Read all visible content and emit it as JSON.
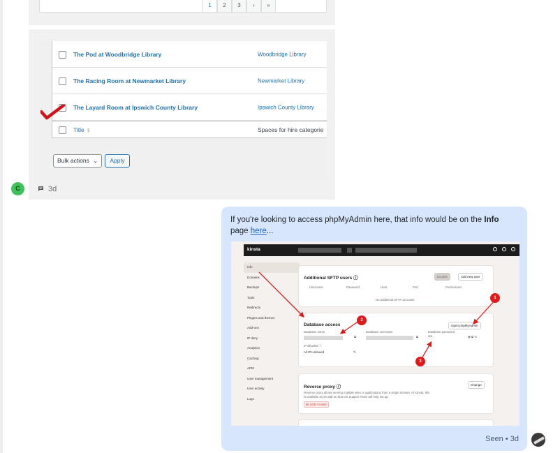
{
  "incoming": {
    "pagination": [
      "1",
      "2",
      "3",
      "›",
      "»"
    ],
    "rows": [
      {
        "title": "The Pod at Woodbridge Library",
        "library": "Woodbridge Library"
      },
      {
        "title": "The Racing Room at Newmarket Library",
        "library": "Newmarket Library"
      },
      {
        "title": "The Layard Room at Ipswich County Library",
        "library": "Ipswich County Library"
      }
    ],
    "footer": {
      "title": "Title",
      "sort_icon": "sort-arrows-icon",
      "column": "Spaces for hire categorie"
    },
    "bulk_actions": "Bulk actions",
    "apply": "Apply",
    "sender_initial": "C",
    "comment_icon": "comment-icon",
    "time": "3d"
  },
  "outgoing": {
    "text_before": "If you're looking to access phpMyAdmin here, that info would be on the ",
    "bold_word": "Info",
    "text_middle": " page ",
    "link": "here",
    "text_after": "...",
    "seen": "Seen • 3d",
    "kinsta": {
      "logo": "kinsta",
      "sidebar": [
        "Info",
        "Domains",
        "Backups",
        "Tools",
        "Redirects",
        "Plugins and themes",
        "Add-ons",
        "IP deny",
        "Analytics",
        "Caching",
        "APM",
        "User management",
        "User activity",
        "Logs"
      ],
      "sftp": {
        "title": "Additional SFTP users",
        "btn_disabled": "Disable",
        "btn_add": "Add new user",
        "columns": [
          "Username",
          "Password",
          "Host",
          "Port",
          "Permissions"
        ],
        "empty": "No additional SFTP accounts"
      },
      "db": {
        "title": "Database access",
        "open_btn": "Open phpMyAdmin",
        "name_label": "Database name",
        "user_label": "Database username",
        "pass_label": "Database password",
        "pass_value": "••••",
        "ip_label": "IP allowlist",
        "ip_value": "All IPs allowed"
      },
      "proxy": {
        "title": "Reverse proxy",
        "change": "Change",
        "desc1": "Reverse proxy allows serving multiple sites or applications from a single domain. At Kinsta, this",
        "desc2": "is available as an add-on that our Support Team will help set up.",
        "price": "$0 USD / month"
      },
      "annotations": [
        "1",
        "2",
        "3"
      ]
    }
  }
}
